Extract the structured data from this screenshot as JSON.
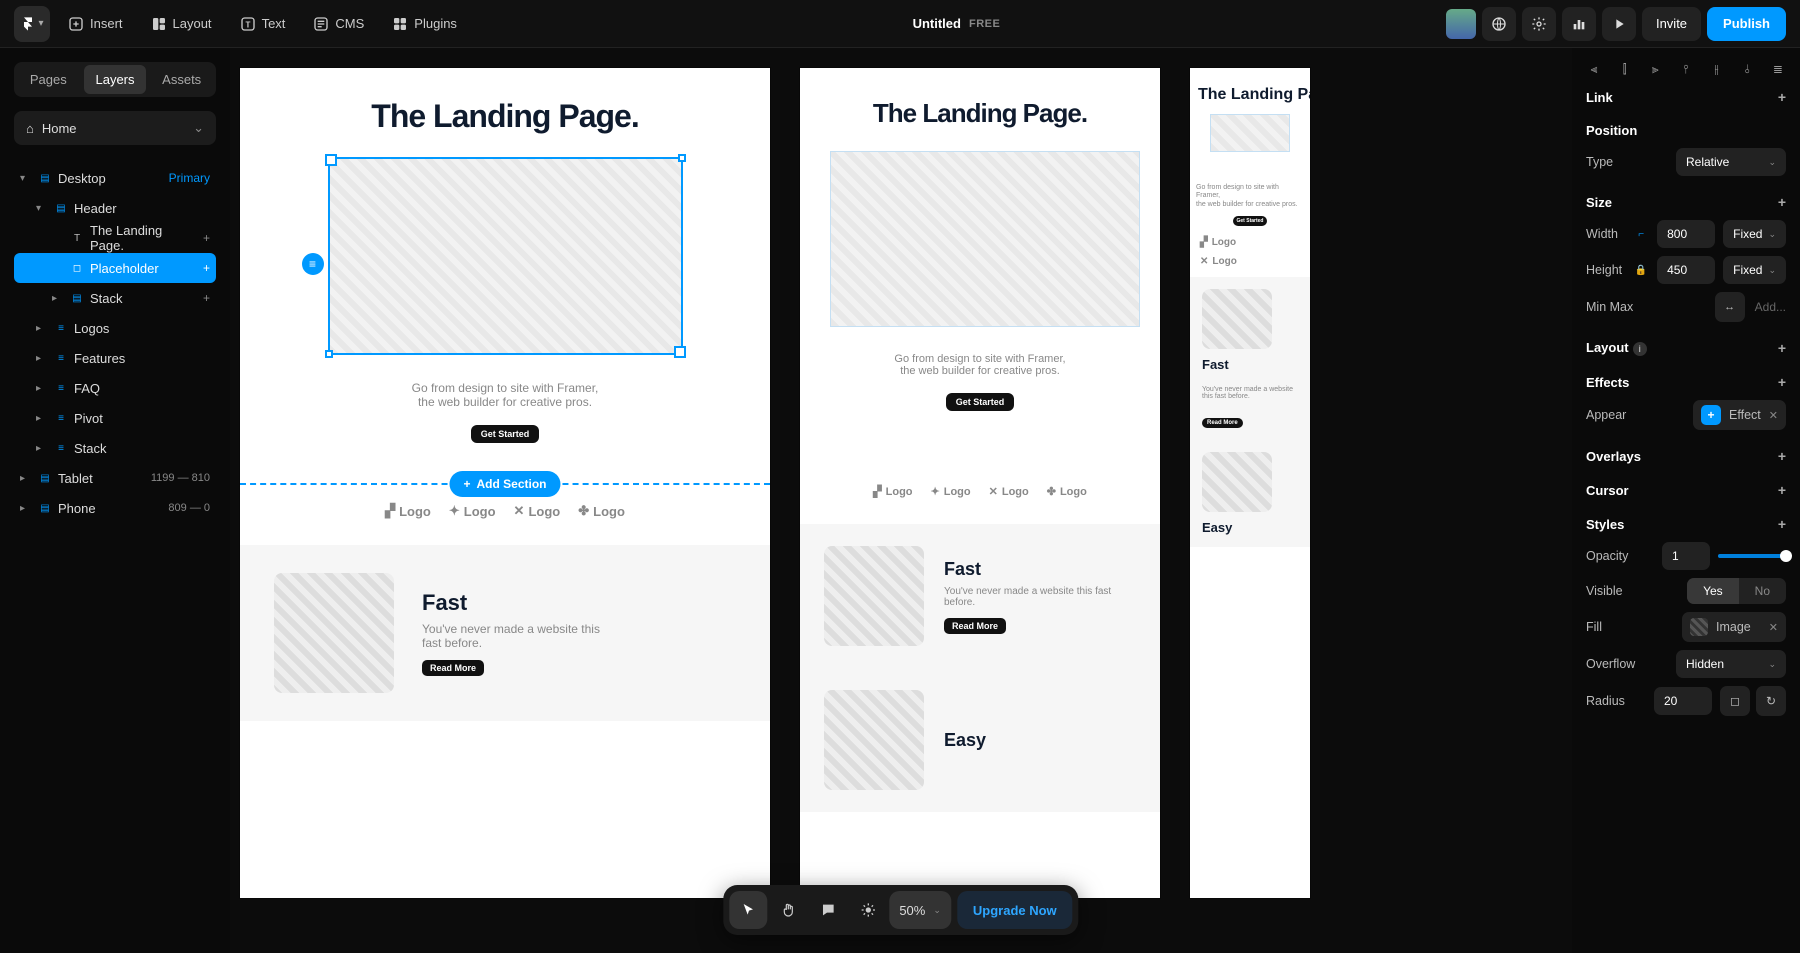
{
  "topbar": {
    "insert": "Insert",
    "layout": "Layout",
    "text": "Text",
    "cms": "CMS",
    "plugins": "Plugins",
    "title": "Untitled",
    "tag": "FREE",
    "invite": "Invite",
    "publish": "Publish"
  },
  "left": {
    "tabs": {
      "pages": "Pages",
      "layers": "Layers",
      "assets": "Assets"
    },
    "breadcrumb": "Home",
    "tree": {
      "desktop": "Desktop",
      "desktop_tag": "Primary",
      "header": "Header",
      "landing_text": "The Landing Page.",
      "placeholder": "Placeholder",
      "stack1": "Stack",
      "logos": "Logos",
      "features": "Features",
      "faq": "FAQ",
      "pivot": "Pivot",
      "stack2": "Stack",
      "tablet": "Tablet",
      "tablet_meta": "1199 — 810",
      "phone": "Phone",
      "phone_meta": "809 — 0"
    }
  },
  "canvas": {
    "heading": "The Landing Page.",
    "sub1": "Go from design to site with Framer,",
    "sub2": "the web builder for creative pros.",
    "cta": "Get Started",
    "add_section": "Add Section",
    "logo_label": "Logo",
    "feature": {
      "title": "Fast",
      "desc": "You've never made a website this fast before.",
      "readmore": "Read More",
      "title2": "Easy"
    },
    "float": {
      "zoom": "50%",
      "upgrade": "Upgrade Now"
    }
  },
  "right": {
    "link": "Link",
    "position": "Position",
    "type": "Type",
    "type_val": "Relative",
    "size": "Size",
    "width": "Width",
    "width_val": "800",
    "height": "Height",
    "height_val": "450",
    "fixed": "Fixed",
    "minmax": "Min Max",
    "minmax_add": "Add...",
    "layout": "Layout",
    "effects": "Effects",
    "appear": "Appear",
    "effect_label": "Effect",
    "overlays": "Overlays",
    "cursor": "Cursor",
    "styles": "Styles",
    "opacity": "Opacity",
    "opacity_val": "1",
    "visible": "Visible",
    "yes": "Yes",
    "no": "No",
    "fill": "Fill",
    "fill_val": "Image",
    "overflow": "Overflow",
    "overflow_val": "Hidden",
    "radius": "Radius",
    "radius_val": "20"
  }
}
